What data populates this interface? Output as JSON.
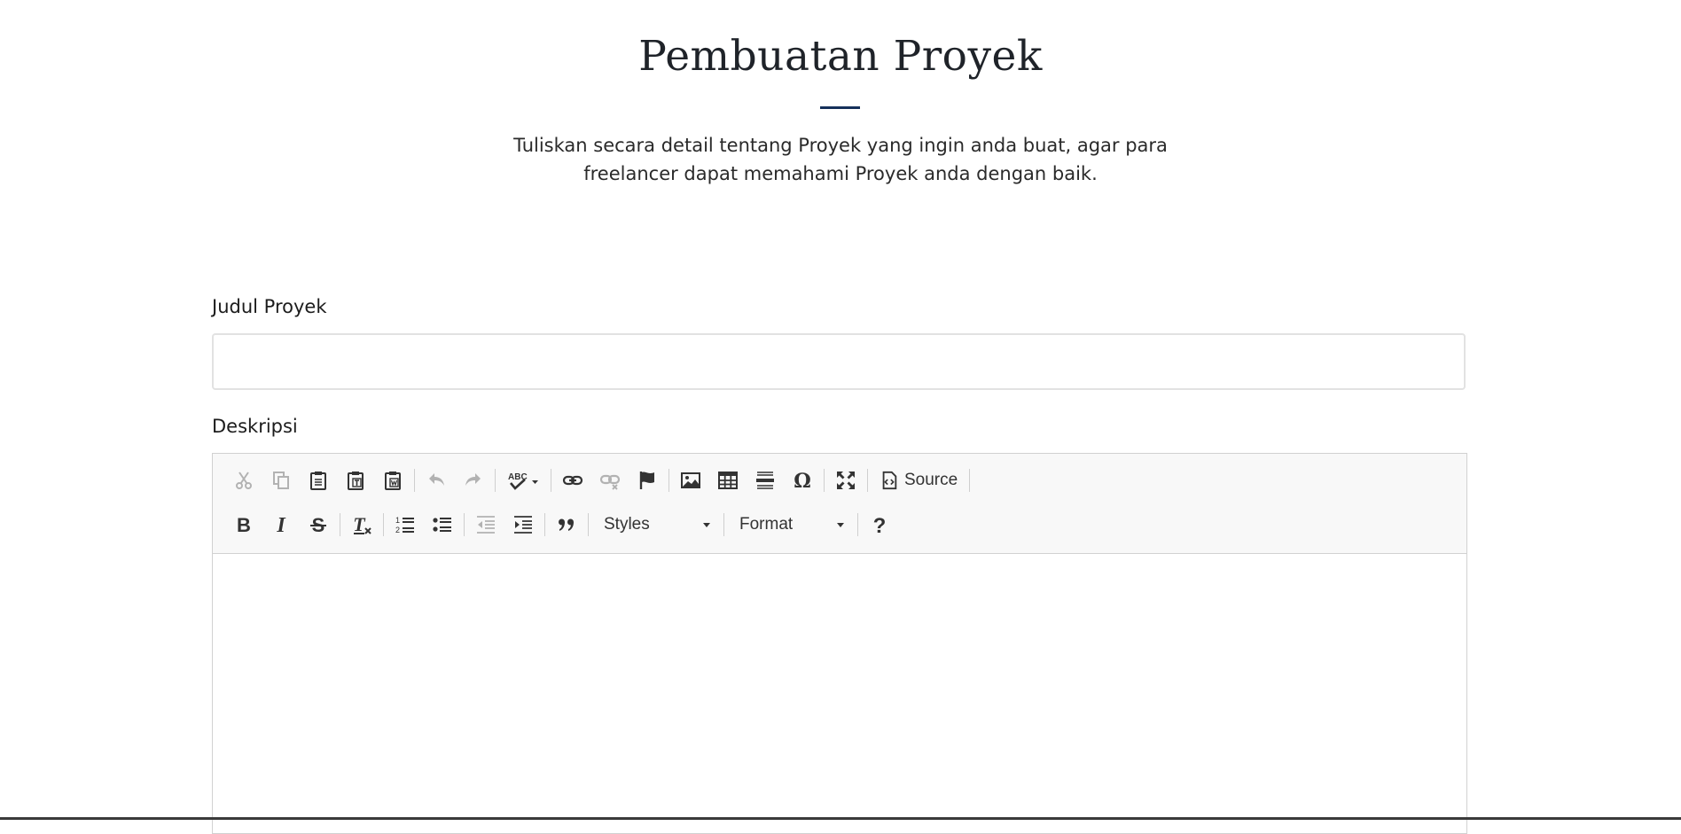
{
  "page": {
    "title": "Pembuatan Proyek",
    "subtitle": "Tuliskan secara detail tentang Proyek yang ingin anda buat, agar para freelancer dapat memahami Proyek anda dengan baik."
  },
  "form": {
    "title_label": "Judul Proyek",
    "title_value": "",
    "description_label": "Deskripsi"
  },
  "editor": {
    "source_label": "Source",
    "styles_label": "Styles",
    "format_label": "Format",
    "content": ""
  },
  "colors": {
    "accent": "#15305a",
    "toolbar_bg": "#f8f8f8",
    "border": "#d1d1d1"
  }
}
